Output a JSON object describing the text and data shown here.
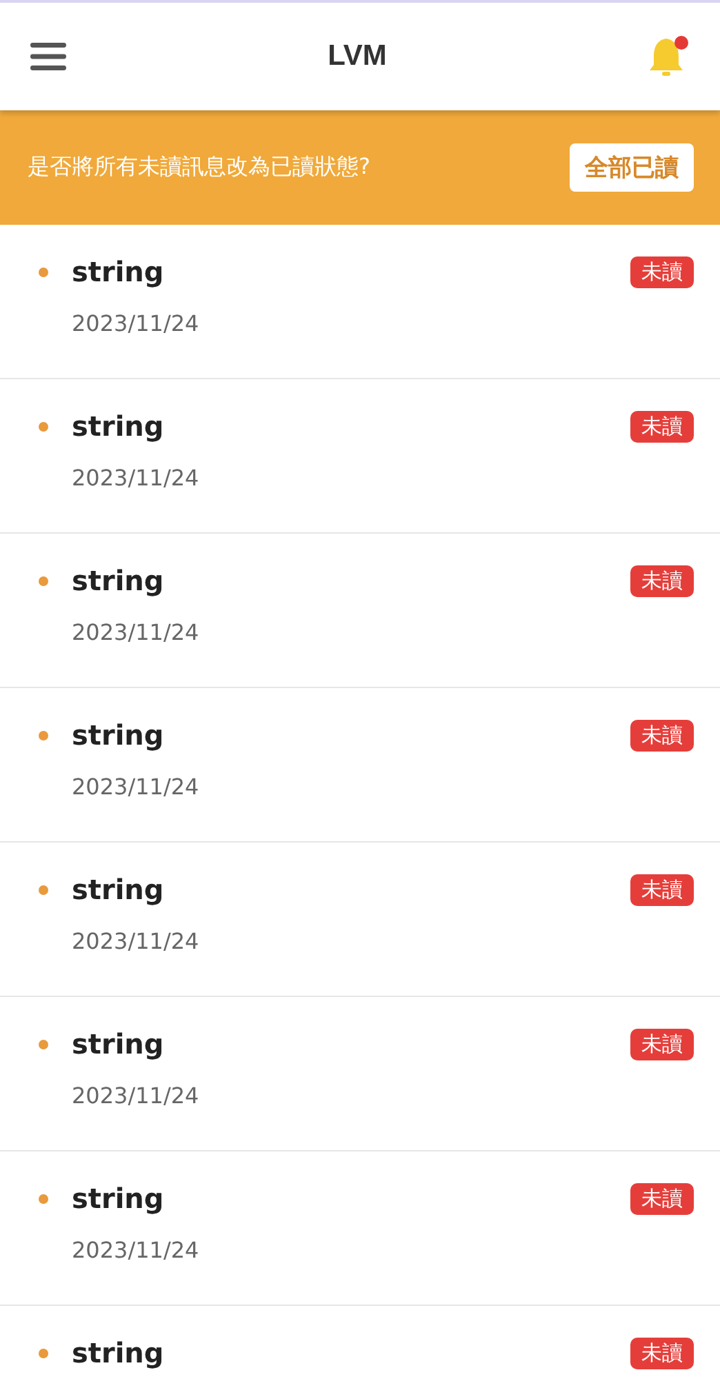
{
  "header": {
    "title": "LVM",
    "has_notification": true
  },
  "banner": {
    "message": "是否將所有未讀訊息改為已讀狀態?",
    "button": "全部已讀"
  },
  "messages": [
    {
      "title": "string",
      "date": "2023/11/24",
      "unread": true,
      "badge": "未讀"
    },
    {
      "title": "string",
      "date": "2023/11/24",
      "unread": true,
      "badge": "未讀"
    },
    {
      "title": "string",
      "date": "2023/11/24",
      "unread": true,
      "badge": "未讀"
    },
    {
      "title": "string",
      "date": "2023/11/24",
      "unread": true,
      "badge": "未讀"
    },
    {
      "title": "string",
      "date": "2023/11/24",
      "unread": true,
      "badge": "未讀"
    },
    {
      "title": "string",
      "date": "2023/11/24",
      "unread": true,
      "badge": "未讀"
    },
    {
      "title": "string",
      "date": "2023/11/24",
      "unread": true,
      "badge": "未讀"
    },
    {
      "title": "string",
      "unread": true,
      "badge": "未讀"
    }
  ]
}
